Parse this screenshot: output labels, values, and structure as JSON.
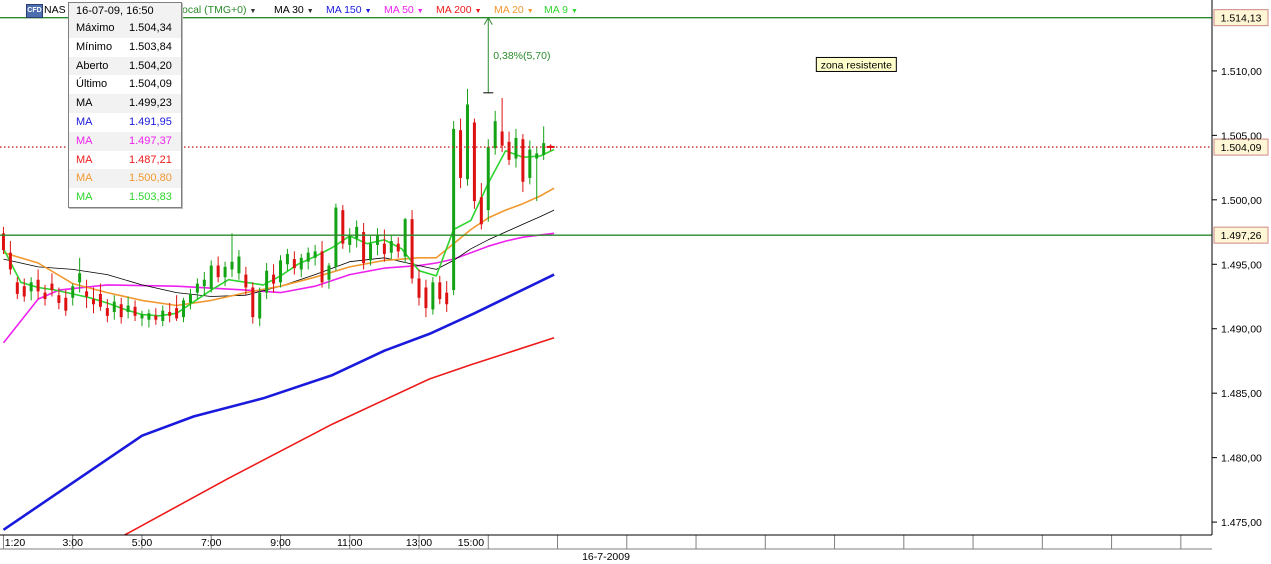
{
  "toolbar": {
    "instrument": "NAS",
    "instrument_icon": "CFD",
    "timezone": "ocal (TMG+0)",
    "ma_buttons": [
      {
        "label": "MA 30",
        "color": "#000000"
      },
      {
        "label": "MA 150",
        "color": "#1a1adc"
      },
      {
        "label": "MA 50",
        "color": "#ee22ee"
      },
      {
        "label": "MA 200",
        "color": "#ee1a1a"
      },
      {
        "label": "MA 20",
        "color": "#f2982f"
      },
      {
        "label": "MA 9",
        "color": "#2fd52f"
      }
    ]
  },
  "tooltip": {
    "datetime": "16-07-09, 16:50",
    "rows": [
      {
        "label": "Máximo",
        "value": "1.504,34",
        "color": "#000000"
      },
      {
        "label": "Mínimo",
        "value": "1.503,84",
        "color": "#000000"
      },
      {
        "label": "Aberto",
        "value": "1.504,20",
        "color": "#000000"
      },
      {
        "label": "Último",
        "value": "1.504,09",
        "color": "#000000"
      },
      {
        "label": "MA",
        "value": "1.499,23",
        "color": "#000000"
      },
      {
        "label": "MA",
        "value": "1.491,95",
        "color": "#1a1adc"
      },
      {
        "label": "MA",
        "value": "1.497,37",
        "color": "#ee22ee"
      },
      {
        "label": "MA",
        "value": "1.487,21",
        "color": "#ee1a1a"
      },
      {
        "label": "MA",
        "value": "1.500,80",
        "color": "#f2982f"
      },
      {
        "label": "MA",
        "value": "1.503,83",
        "color": "#2fd52f"
      }
    ]
  },
  "chart_data": {
    "type": "candlestick",
    "date": "16-7-2009",
    "ylim": [
      1474.0,
      1515.5
    ],
    "y_ticks": [
      {
        "value": 1475.0,
        "label": "1.475,00"
      },
      {
        "value": 1480.0,
        "label": "1.480,00"
      },
      {
        "value": 1485.0,
        "label": "1.485,00"
      },
      {
        "value": 1490.0,
        "label": "1.490,00"
      },
      {
        "value": 1495.0,
        "label": "1.495,00"
      },
      {
        "value": 1500.0,
        "label": "1.500,00"
      },
      {
        "value": 1505.0,
        "label": "1.505,00"
      },
      {
        "value": 1510.0,
        "label": "1.510,00"
      }
    ],
    "time_labels": [
      "1:20",
      "3:00",
      "5:00",
      "7:00",
      "9:00",
      "11:00",
      "13:00",
      "15:00"
    ],
    "time_label_times": [
      1.333,
      3,
      5,
      7,
      9,
      11,
      13,
      14.5
    ],
    "x_gridlines": [
      1,
      3,
      5,
      7,
      9,
      11,
      13,
      15,
      17,
      19,
      21,
      23,
      25,
      27,
      29,
      31,
      33,
      35
    ],
    "xlim": [
      0.9,
      35.9
    ],
    "candles": [
      {
        "t": 1.0,
        "o": 1497.4,
        "h": 1497.9,
        "l": 1495.8,
        "c": 1496.1
      },
      {
        "t": 1.2,
        "o": 1495.9,
        "h": 1496.8,
        "l": 1494.2,
        "c": 1494.6
      },
      {
        "t": 1.4,
        "o": 1493.6,
        "h": 1494.0,
        "l": 1492.3,
        "c": 1492.7
      },
      {
        "t": 1.6,
        "o": 1493.3,
        "h": 1493.9,
        "l": 1492.1,
        "c": 1492.5
      },
      {
        "t": 1.8,
        "o": 1492.9,
        "h": 1494.0,
        "l": 1492.2,
        "c": 1493.6
      },
      {
        "t": 2.0,
        "o": 1493.8,
        "h": 1494.6,
        "l": 1492.3,
        "c": 1492.9
      },
      {
        "t": 2.2,
        "o": 1492.8,
        "h": 1493.4,
        "l": 1491.8,
        "c": 1492.3
      },
      {
        "t": 2.4,
        "o": 1493.5,
        "h": 1494.3,
        "l": 1492.5,
        "c": 1493.0
      },
      {
        "t": 2.6,
        "o": 1492.6,
        "h": 1493.2,
        "l": 1491.5,
        "c": 1492.0
      },
      {
        "t": 2.8,
        "o": 1492.4,
        "h": 1493.0,
        "l": 1491.0,
        "c": 1491.4
      },
      {
        "t": 3.0,
        "o": 1492.4,
        "h": 1493.5,
        "l": 1491.8,
        "c": 1493.3
      },
      {
        "t": 3.2,
        "o": 1493.6,
        "h": 1495.5,
        "l": 1492.8,
        "c": 1494.3
      },
      {
        "t": 3.4,
        "o": 1492.9,
        "h": 1493.8,
        "l": 1491.6,
        "c": 1492.5
      },
      {
        "t": 3.6,
        "o": 1492.3,
        "h": 1493.2,
        "l": 1491.2,
        "c": 1491.9
      },
      {
        "t": 3.8,
        "o": 1492.7,
        "h": 1493.5,
        "l": 1491.4,
        "c": 1491.7
      },
      {
        "t": 4.0,
        "o": 1491.6,
        "h": 1492.3,
        "l": 1490.5,
        "c": 1491.0
      },
      {
        "t": 4.2,
        "o": 1491.3,
        "h": 1492.6,
        "l": 1490.7,
        "c": 1492.1
      },
      {
        "t": 4.4,
        "o": 1491.9,
        "h": 1492.4,
        "l": 1490.4,
        "c": 1490.9
      },
      {
        "t": 4.6,
        "o": 1491.3,
        "h": 1492.5,
        "l": 1490.8,
        "c": 1491.8
      },
      {
        "t": 4.8,
        "o": 1491.7,
        "h": 1492.2,
        "l": 1490.6,
        "c": 1491.0
      },
      {
        "t": 5.0,
        "o": 1490.8,
        "h": 1491.4,
        "l": 1490.2,
        "c": 1491.1
      },
      {
        "t": 5.2,
        "o": 1490.7,
        "h": 1491.5,
        "l": 1490.1,
        "c": 1491.2
      },
      {
        "t": 5.4,
        "o": 1491.0,
        "h": 1491.6,
        "l": 1490.3,
        "c": 1490.7
      },
      {
        "t": 5.6,
        "o": 1490.6,
        "h": 1491.8,
        "l": 1490.2,
        "c": 1491.4
      },
      {
        "t": 5.8,
        "o": 1491.3,
        "h": 1492.0,
        "l": 1490.5,
        "c": 1491.0
      },
      {
        "t": 6.0,
        "o": 1491.6,
        "h": 1492.6,
        "l": 1490.6,
        "c": 1490.8
      },
      {
        "t": 6.2,
        "o": 1490.9,
        "h": 1492.4,
        "l": 1490.5,
        "c": 1492.2
      },
      {
        "t": 6.4,
        "o": 1492.0,
        "h": 1493.1,
        "l": 1491.5,
        "c": 1492.7
      },
      {
        "t": 6.6,
        "o": 1492.8,
        "h": 1493.9,
        "l": 1492.3,
        "c": 1493.5
      },
      {
        "t": 6.8,
        "o": 1493.3,
        "h": 1494.4,
        "l": 1492.6,
        "c": 1493.8
      },
      {
        "t": 7.0,
        "o": 1493.1,
        "h": 1495.3,
        "l": 1492.8,
        "c": 1494.9
      },
      {
        "t": 7.2,
        "o": 1494.9,
        "h": 1495.6,
        "l": 1493.6,
        "c": 1494.0
      },
      {
        "t": 7.4,
        "o": 1494.0,
        "h": 1495.2,
        "l": 1493.3,
        "c": 1494.8
      },
      {
        "t": 7.6,
        "o": 1494.6,
        "h": 1497.4,
        "l": 1494.0,
        "c": 1495.2
      },
      {
        "t": 7.8,
        "o": 1494.3,
        "h": 1496.1,
        "l": 1493.8,
        "c": 1495.6
      },
      {
        "t": 8.0,
        "o": 1494.2,
        "h": 1494.8,
        "l": 1492.6,
        "c": 1493.2
      },
      {
        "t": 8.2,
        "o": 1493.2,
        "h": 1493.6,
        "l": 1490.4,
        "c": 1490.9
      },
      {
        "t": 8.4,
        "o": 1490.8,
        "h": 1493.2,
        "l": 1490.2,
        "c": 1492.8
      },
      {
        "t": 8.6,
        "o": 1492.8,
        "h": 1495.1,
        "l": 1492.3,
        "c": 1494.5
      },
      {
        "t": 8.8,
        "o": 1494.2,
        "h": 1495.0,
        "l": 1492.8,
        "c": 1493.5
      },
      {
        "t": 9.0,
        "o": 1493.6,
        "h": 1495.7,
        "l": 1493.2,
        "c": 1495.3
      },
      {
        "t": 9.2,
        "o": 1495.0,
        "h": 1496.2,
        "l": 1494.5,
        "c": 1495.8
      },
      {
        "t": 9.4,
        "o": 1495.4,
        "h": 1496.0,
        "l": 1494.2,
        "c": 1494.7
      },
      {
        "t": 9.6,
        "o": 1494.6,
        "h": 1495.8,
        "l": 1494.0,
        "c": 1495.5
      },
      {
        "t": 9.8,
        "o": 1495.2,
        "h": 1496.3,
        "l": 1494.6,
        "c": 1495.9
      },
      {
        "t": 10.0,
        "o": 1495.5,
        "h": 1496.5,
        "l": 1494.9,
        "c": 1496.0
      },
      {
        "t": 10.2,
        "o": 1496.0,
        "h": 1496.8,
        "l": 1493.2,
        "c": 1493.6
      },
      {
        "t": 10.4,
        "o": 1493.8,
        "h": 1495.1,
        "l": 1493.1,
        "c": 1494.9
      },
      {
        "t": 10.6,
        "o": 1494.8,
        "h": 1499.7,
        "l": 1494.5,
        "c": 1499.4
      },
      {
        "t": 10.8,
        "o": 1499.2,
        "h": 1499.6,
        "l": 1496.2,
        "c": 1496.6
      },
      {
        "t": 11.0,
        "o": 1496.5,
        "h": 1497.8,
        "l": 1495.9,
        "c": 1497.2
      },
      {
        "t": 11.2,
        "o": 1497.0,
        "h": 1498.4,
        "l": 1496.3,
        "c": 1497.9
      },
      {
        "t": 11.4,
        "o": 1497.5,
        "h": 1498.2,
        "l": 1494.6,
        "c": 1495.1
      },
      {
        "t": 11.6,
        "o": 1495.3,
        "h": 1497.2,
        "l": 1494.9,
        "c": 1496.6
      },
      {
        "t": 11.8,
        "o": 1496.5,
        "h": 1497.8,
        "l": 1495.7,
        "c": 1497.3
      },
      {
        "t": 12.0,
        "o": 1496.6,
        "h": 1497.7,
        "l": 1495.2,
        "c": 1495.8
      },
      {
        "t": 12.2,
        "o": 1495.9,
        "h": 1497.3,
        "l": 1495.4,
        "c": 1496.8
      },
      {
        "t": 12.4,
        "o": 1496.6,
        "h": 1497.1,
        "l": 1495.5,
        "c": 1496.0
      },
      {
        "t": 12.6,
        "o": 1495.6,
        "h": 1498.6,
        "l": 1495.1,
        "c": 1498.5
      },
      {
        "t": 12.8,
        "o": 1498.5,
        "h": 1499.2,
        "l": 1493.5,
        "c": 1493.9
      },
      {
        "t": 13.0,
        "o": 1493.9,
        "h": 1494.6,
        "l": 1491.8,
        "c": 1492.4
      },
      {
        "t": 13.2,
        "o": 1493.2,
        "h": 1493.8,
        "l": 1490.9,
        "c": 1491.6
      },
      {
        "t": 13.4,
        "o": 1491.5,
        "h": 1494.0,
        "l": 1491.1,
        "c": 1493.6
      },
      {
        "t": 13.6,
        "o": 1493.6,
        "h": 1494.1,
        "l": 1491.9,
        "c": 1492.3
      },
      {
        "t": 13.8,
        "o": 1492.8,
        "h": 1493.7,
        "l": 1491.3,
        "c": 1491.9
      },
      {
        "t": 14.0,
        "o": 1493.0,
        "h": 1506.1,
        "l": 1492.6,
        "c": 1505.5
      },
      {
        "t": 14.2,
        "o": 1505.4,
        "h": 1506.3,
        "l": 1500.9,
        "c": 1501.7
      },
      {
        "t": 14.4,
        "o": 1501.6,
        "h": 1508.6,
        "l": 1501.1,
        "c": 1507.4
      },
      {
        "t": 14.6,
        "o": 1506.0,
        "h": 1506.3,
        "l": 1499.3,
        "c": 1499.9
      },
      {
        "t": 14.8,
        "o": 1500.2,
        "h": 1501.3,
        "l": 1497.7,
        "c": 1498.1
      },
      {
        "t": 15.0,
        "o": 1499.2,
        "h": 1504.7,
        "l": 1498.3,
        "c": 1504.1
      },
      {
        "t": 15.2,
        "o": 1504.0,
        "h": 1506.9,
        "l": 1503.5,
        "c": 1506.1
      },
      {
        "t": 15.4,
        "o": 1505.3,
        "h": 1507.9,
        "l": 1503.7,
        "c": 1504.2
      },
      {
        "t": 15.6,
        "o": 1504.5,
        "h": 1505.3,
        "l": 1502.7,
        "c": 1503.1
      },
      {
        "t": 15.8,
        "o": 1503.2,
        "h": 1505.5,
        "l": 1502.5,
        "c": 1504.8
      },
      {
        "t": 16.0,
        "o": 1504.7,
        "h": 1505.1,
        "l": 1500.6,
        "c": 1501.4
      },
      {
        "t": 16.2,
        "o": 1501.7,
        "h": 1504.6,
        "l": 1501.2,
        "c": 1503.9
      },
      {
        "t": 16.4,
        "o": 1503.2,
        "h": 1504.1,
        "l": 1499.9,
        "c": 1503.6
      },
      {
        "t": 16.6,
        "o": 1503.5,
        "h": 1505.7,
        "l": 1503.1,
        "c": 1504.4
      },
      {
        "t": 16.8,
        "o": 1504.2,
        "h": 1504.3,
        "l": 1503.8,
        "c": 1504.1
      }
    ],
    "moving_averages": [
      {
        "name": "MA 200",
        "color": "#ee1a1a",
        "width": 1.6,
        "t": [
          4.5,
          7.5,
          10.5,
          13.3,
          14.5,
          16.9
        ],
        "v": [
          1474.0,
          1478.4,
          1482.6,
          1486.1,
          1487.2,
          1489.3
        ]
      },
      {
        "name": "MA 150",
        "color": "#1a1adc",
        "width": 2.6,
        "t": [
          1.0,
          5.0,
          6.5,
          8.5,
          10.5,
          12.0,
          13.3,
          14.6,
          16.9
        ],
        "v": [
          1474.4,
          1481.7,
          1483.2,
          1484.6,
          1486.4,
          1488.3,
          1489.6,
          1491.2,
          1494.2
        ]
      },
      {
        "name": "MA 50",
        "color": "#ee22ee",
        "width": 1.6,
        "t": [
          1.0,
          2.0,
          2.6,
          4.0,
          6.0,
          8.0,
          9.0,
          10.0,
          11.0,
          12.0,
          13.0,
          13.5,
          14.0,
          14.5,
          15.0,
          15.5,
          16.0,
          16.6,
          16.9
        ],
        "v": [
          1488.9,
          1492.3,
          1493.0,
          1493.4,
          1493.3,
          1493.0,
          1492.8,
          1493.3,
          1494.2,
          1494.7,
          1494.9,
          1495.1,
          1495.4,
          1495.9,
          1496.4,
          1496.8,
          1497.1,
          1497.3,
          1497.4
        ]
      },
      {
        "name": "MA 30",
        "color": "#000000",
        "width": 0.8,
        "t": [
          1.0,
          2.0,
          3.0,
          4.0,
          5.0,
          6.0,
          7.0,
          8.0,
          9.0,
          10.0,
          11.0,
          12.0,
          13.0,
          13.5,
          14.0,
          14.5,
          15.0,
          15.5,
          16.0,
          16.5,
          16.9
        ],
        "v": [
          1495.4,
          1494.8,
          1494.6,
          1494.2,
          1493.4,
          1492.8,
          1492.5,
          1492.6,
          1493.3,
          1494.2,
          1495.2,
          1495.5,
          1494.9,
          1494.6,
          1495.3,
          1496.2,
          1496.9,
          1497.5,
          1498.1,
          1498.7,
          1499.2
        ]
      },
      {
        "name": "MA 20",
        "color": "#f2982f",
        "width": 1.6,
        "t": [
          1.0,
          2.0,
          3.0,
          4.0,
          5.0,
          6.0,
          7.0,
          8.0,
          9.0,
          10.0,
          11.0,
          12.0,
          13.0,
          13.5,
          14.0,
          14.5,
          15.0,
          15.5,
          16.0,
          16.5,
          16.9
        ],
        "v": [
          1495.9,
          1495.1,
          1493.5,
          1492.8,
          1492.2,
          1491.8,
          1492.2,
          1492.8,
          1493.3,
          1494.0,
          1494.8,
          1495.3,
          1495.5,
          1495.5,
          1496.6,
          1497.7,
          1498.6,
          1499.2,
          1499.7,
          1500.3,
          1500.9
        ]
      },
      {
        "name": "MA 9",
        "color": "#2fd52f",
        "width": 1.6,
        "t": [
          1.0,
          1.5,
          2.0,
          2.5,
          3.0,
          3.5,
          4.0,
          4.5,
          5.0,
          5.5,
          6.0,
          6.5,
          7.0,
          7.5,
          8.0,
          8.5,
          9.0,
          9.5,
          10.0,
          10.5,
          11.0,
          11.5,
          12.0,
          12.5,
          13.0,
          13.5,
          14.0,
          14.5,
          15.0,
          15.5,
          16.0,
          16.5,
          16.9
        ],
        "v": [
          1496.2,
          1493.6,
          1493.2,
          1493.0,
          1492.7,
          1492.4,
          1492.0,
          1491.5,
          1491.1,
          1491.0,
          1491.2,
          1492.1,
          1493.0,
          1493.8,
          1493.6,
          1493.4,
          1494.1,
          1495.0,
          1495.6,
          1496.3,
          1497.2,
          1496.6,
          1496.9,
          1496.2,
          1494.5,
          1494.1,
          1497.7,
          1498.4,
          1501.3,
          1503.8,
          1503.3,
          1503.4,
          1503.9
        ]
      }
    ],
    "horizontal_lines": [
      {
        "value": 1514.13,
        "label": "1.514,13",
        "color": "#2b8a2b",
        "style": "solid"
      },
      {
        "value": 1504.09,
        "label": "1.504,09",
        "color": "#c62828",
        "style": "dotted"
      },
      {
        "value": 1497.26,
        "label": "1.497,26",
        "color": "#2b8a2b",
        "style": "solid"
      }
    ],
    "measure": {
      "t": 15.0,
      "from": 1508.3,
      "to": 1514.13,
      "label": "0,38%(5,70)",
      "color": "#2b8a2b"
    },
    "annotation": {
      "text": "zona resistente",
      "t": 25.6,
      "value": 1510.5
    },
    "grid": false
  }
}
